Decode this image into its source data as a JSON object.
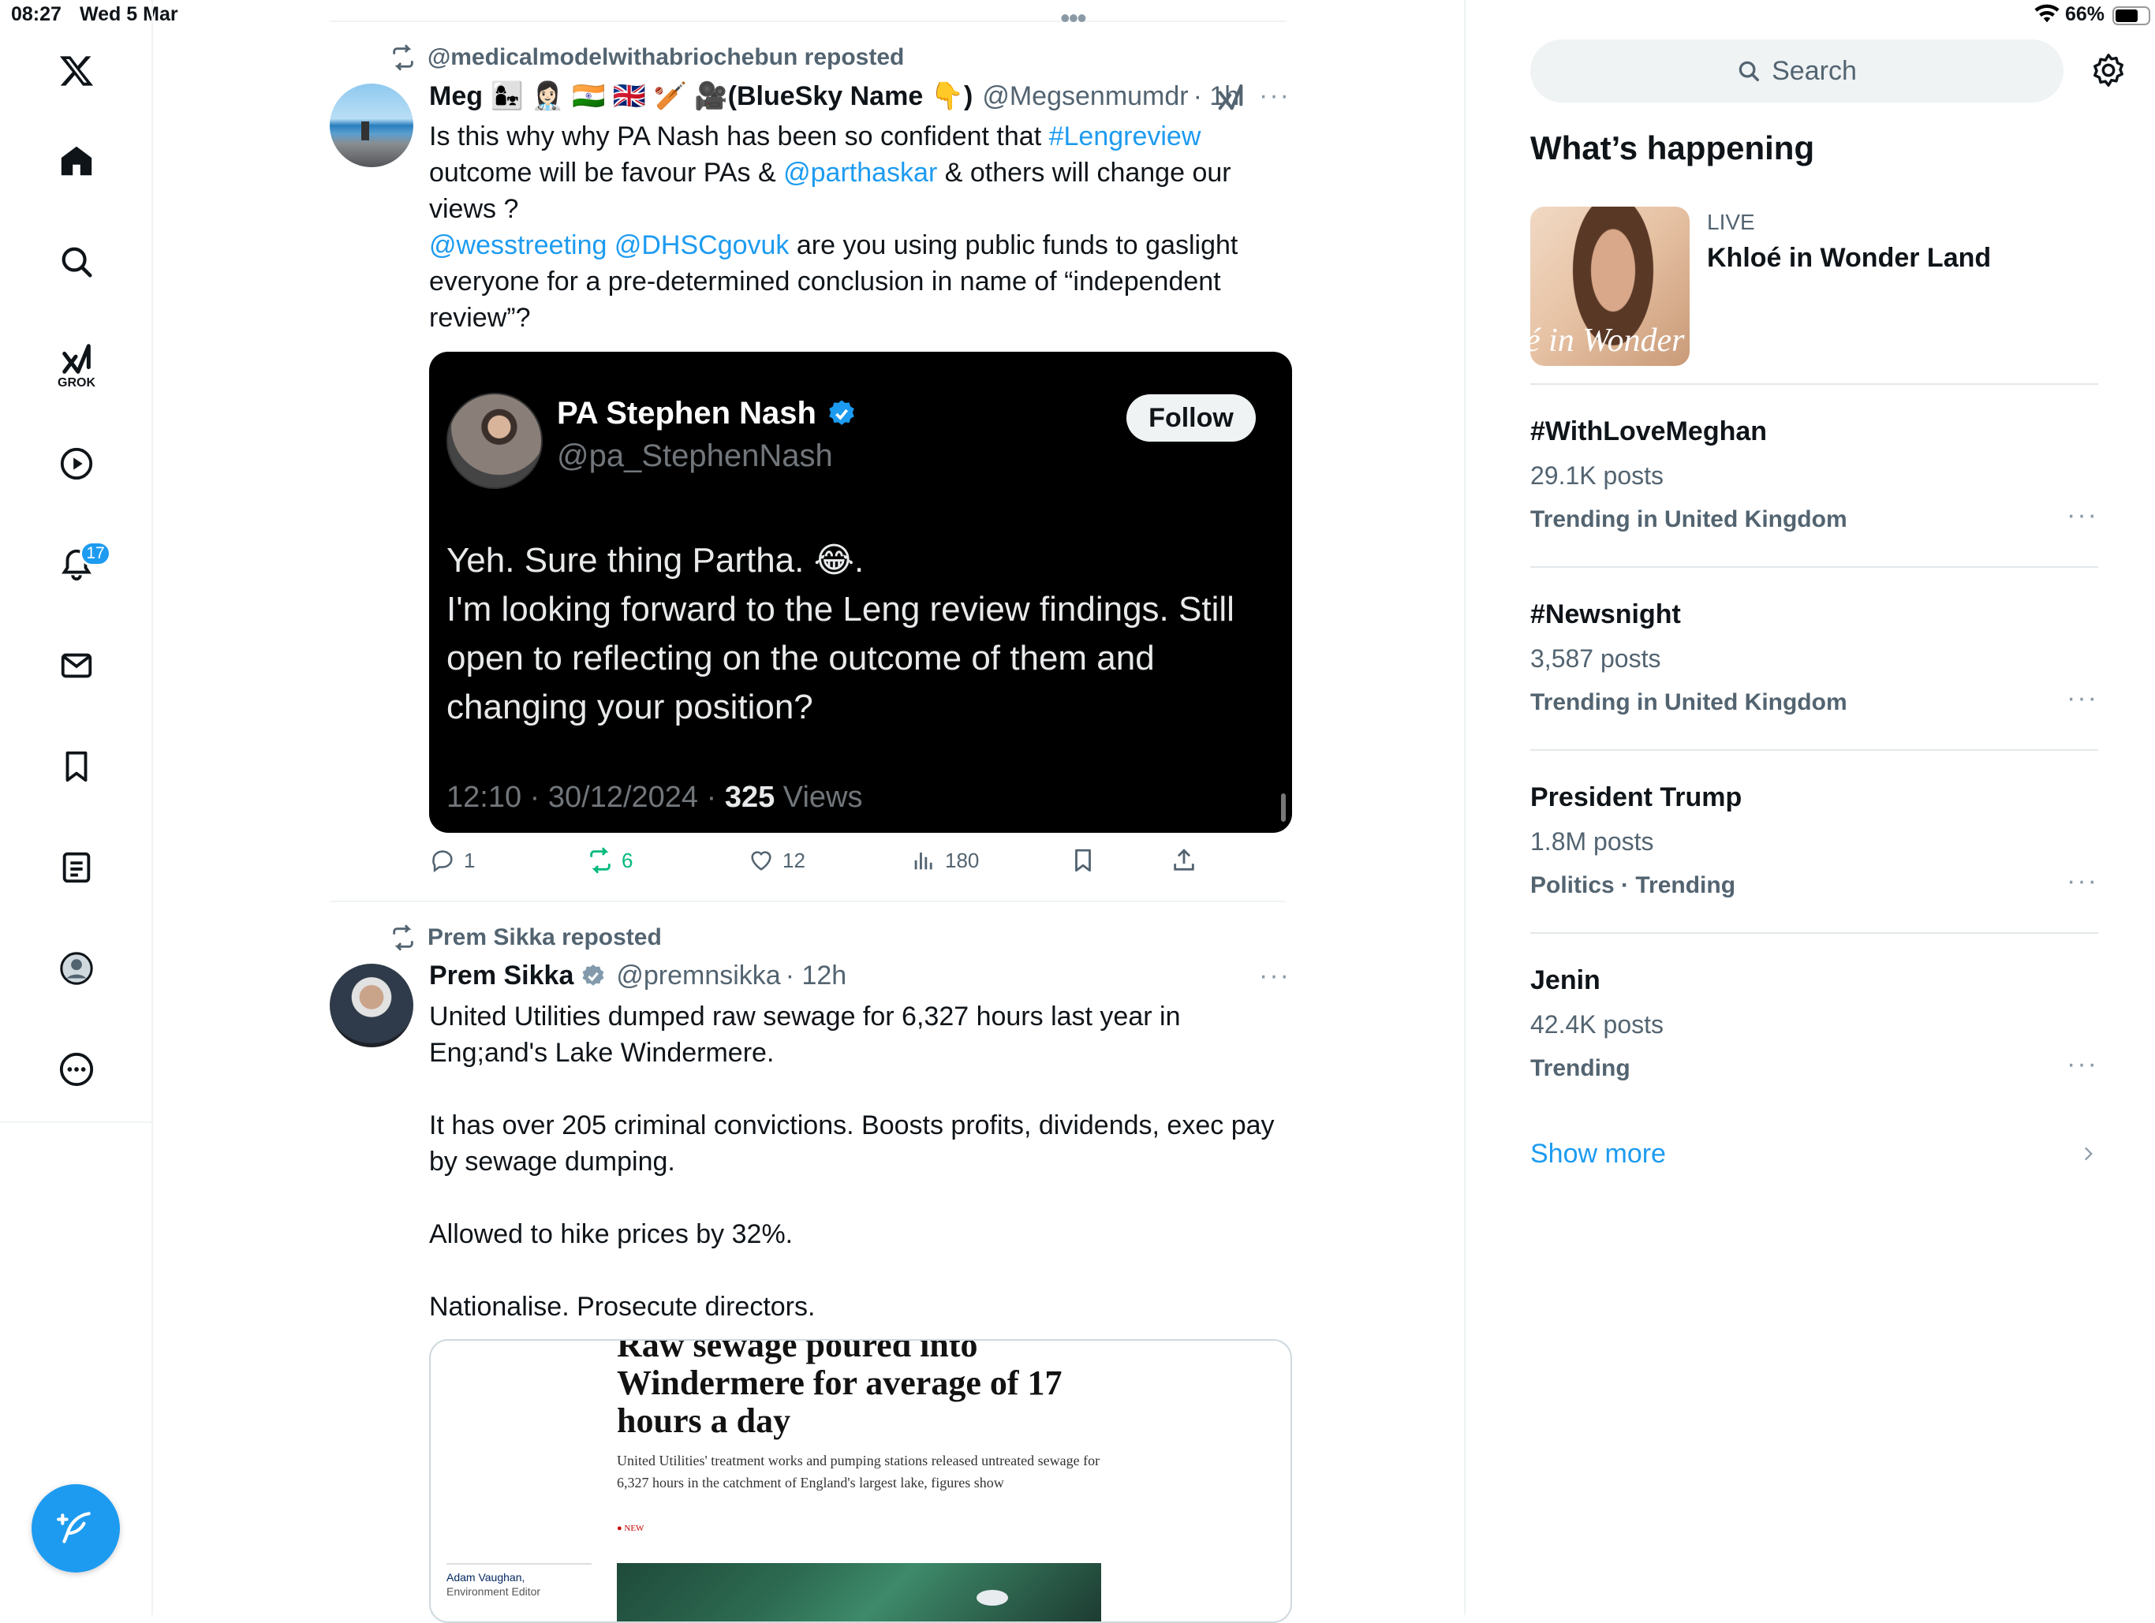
{
  "status": {
    "time": "08:27",
    "date": "Wed 5 Mar",
    "battery": "66%"
  },
  "nav": {
    "grok_label": "GROK",
    "notif_count": "17"
  },
  "tweet1": {
    "repost_text": "@medicalmodelwithabriochebun reposted",
    "name": "Meg 👩‍👧 👩🏻‍⚕️ 🇮🇳 🇬🇧 🏏 🎥(BlueSky Name 👇)",
    "handle": "@Megsenmumdr",
    "time": "· 1h",
    "text_a": "Is this why why PA Nash has been so confident that ",
    "tag_lengreview": "#Lengreview",
    "text_b": "outcome will be favour PAs & ",
    "mention_partha": "@parthaskar",
    "text_c": " & others will change our views ?",
    "mention_wes": "@wesstreeting",
    "mention_dhsc": "@DHSCgovuk",
    "text_d": " are you using public funds to gaslight everyone for a pre-determined conclusion in name of “independent review”?",
    "embed": {
      "name": "PA Stephen Nash",
      "handle": "@pa_StephenNash",
      "follow_label": "Follow",
      "text": "Yeh. Sure thing Partha. 😂.\nI'm looking forward to the Leng review findings. Still open to reflecting on the outcome of them and changing your position?",
      "datetime": "12:10 · 30/12/2024 · ",
      "views_count": "325",
      "views_label": " Views"
    },
    "replies": "1",
    "reposts": "6",
    "likes": "12",
    "views": "180"
  },
  "tweet2": {
    "repost_text": "Prem Sikka reposted",
    "name": "Prem Sikka",
    "handle": "@premnsikka",
    "time": "· 12h",
    "text": "United Utilities dumped raw sewage for 6,327 hours last year in Eng;and's Lake Windermere.\n\nIt has over 205 criminal convictions. Boosts profits, dividends, exec pay by sewage dumping.\n\nAllowed to hike prices by 32%.\n\nNationalise. Prosecute directors.",
    "card": {
      "headline": "Raw sewage poured into Windermere for average of 17 hours a day",
      "subhead": "United Utilities' treatment works and pumping stations released untreated sewage for 6,327 hours in the catchment of England's largest lake, figures show",
      "new_label": "● NEW",
      "author": "Adam Vaughan,",
      "author_role": "Environment Editor"
    }
  },
  "right": {
    "search_placeholder": "Search",
    "heading": "What’s happening",
    "live": {
      "label": "LIVE",
      "title": "Khloé in Wonder Land",
      "thumb_text": "é in Wonder l"
    },
    "trends": [
      {
        "name": "#WithLoveMeghan",
        "posts": "29.1K posts",
        "context": "Trending in United Kingdom"
      },
      {
        "name": "#Newsnight",
        "posts": "3,587 posts",
        "context": "Trending in United Kingdom"
      },
      {
        "name": "President Trump",
        "posts": "1.8M posts",
        "context": "Politics · Trending"
      },
      {
        "name": "Jenin",
        "posts": "42.4K posts",
        "context": "Trending"
      }
    ],
    "show_more": "Show more"
  },
  "colors": {
    "accent": "#1d9bf0",
    "repost_green": "#00ba7c",
    "text": "#0f1419",
    "muted": "#536471"
  }
}
